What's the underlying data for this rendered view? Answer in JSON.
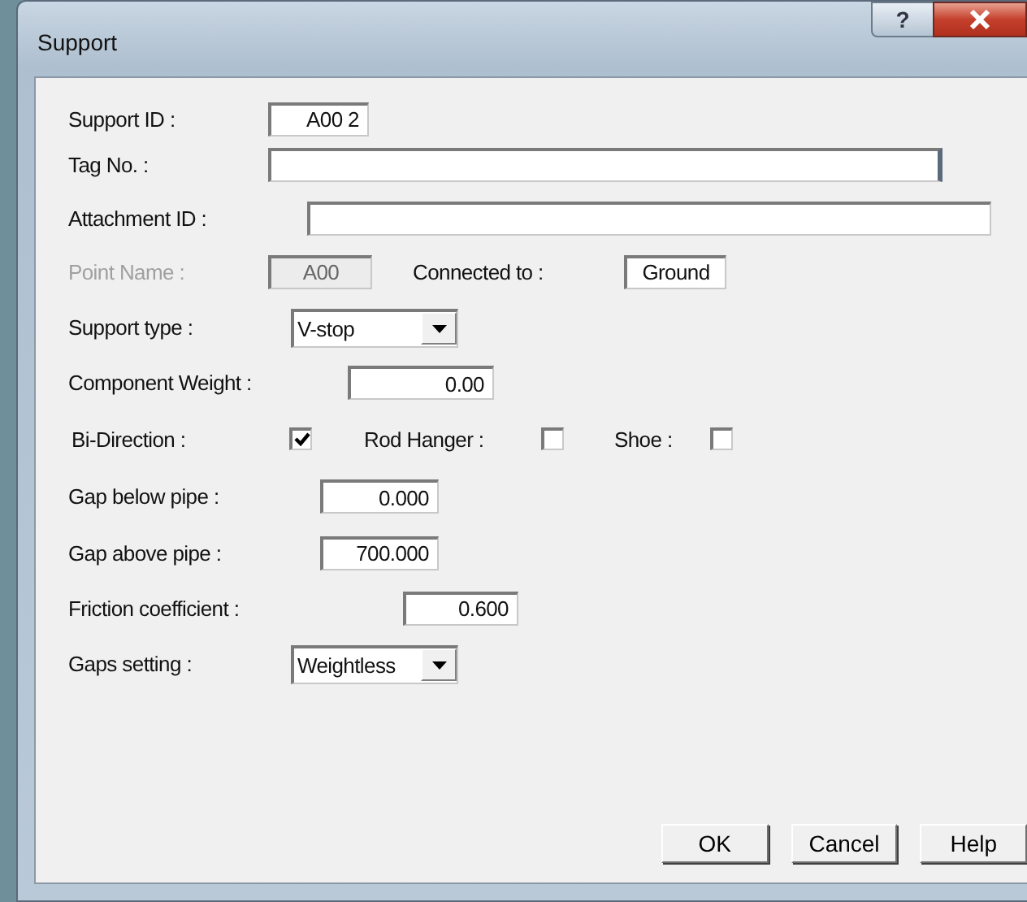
{
  "window": {
    "title": "Support",
    "help_button": "?"
  },
  "rows": [
    {
      "kind": "field",
      "label": "Support ID :",
      "value": "A00  2",
      "disabled": false
    },
    {
      "kind": "field",
      "label": "Tag No. :",
      "value": "",
      "disabled": false
    },
    {
      "kind": "field",
      "label": "Attachment ID :",
      "value": "",
      "disabled": false
    },
    {
      "kind": "pair",
      "label": "Point Name :",
      "value": "A00",
      "disabled": true,
      "label2": "Connected to :",
      "value2": "Ground"
    },
    {
      "kind": "combo",
      "label": "Support type :",
      "value": "V-stop"
    },
    {
      "kind": "field",
      "label": "Component Weight :",
      "value": "0.00",
      "disabled": false
    },
    {
      "kind": "checks",
      "items": [
        {
          "label": "Bi-Direction :",
          "checked": true
        },
        {
          "label": "Rod Hanger :",
          "checked": false
        },
        {
          "label": "Shoe :",
          "checked": false
        }
      ]
    },
    {
      "kind": "field",
      "label": "Gap below pipe :",
      "value": "0.000",
      "disabled": false
    },
    {
      "kind": "field",
      "label": "Gap above pipe :",
      "value": "700.000",
      "disabled": false
    },
    {
      "kind": "field",
      "label": "Friction coefficient :",
      "value": "0.600",
      "disabled": false
    },
    {
      "kind": "combo",
      "label": "Gaps setting :",
      "value": "Weightless"
    }
  ],
  "buttons": [
    "OK",
    "Cancel",
    "Help"
  ]
}
